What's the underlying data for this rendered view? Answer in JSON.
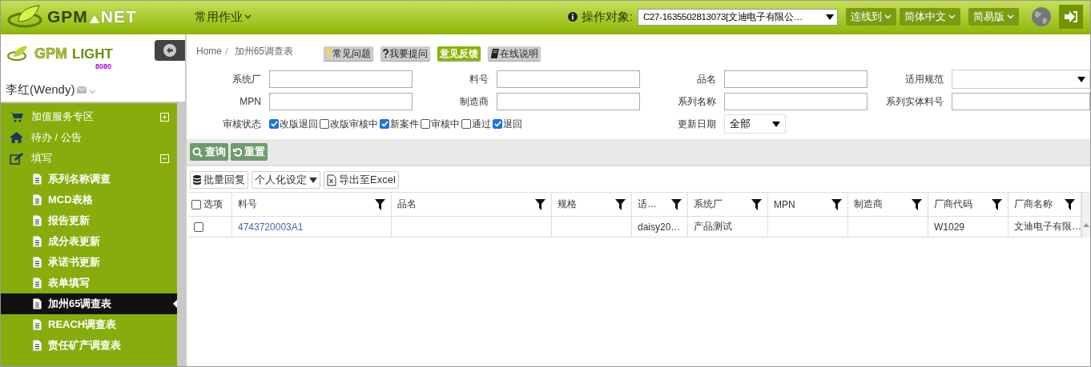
{
  "header": {
    "brand_left": "GPM",
    "brand_right": "NET",
    "menu": "常用作业",
    "operator_label": "操作对象:",
    "operator_value": "C27-1635502813073[文迪电子有限公…",
    "buttons": [
      "连线到",
      "简体中文",
      "简易版"
    ]
  },
  "sidebar": {
    "logo_left": "GPM",
    "logo_right": "LIGHT",
    "logo_sub": "8080",
    "user": "李红(Wendy)",
    "items": [
      {
        "label": "加值服务专区",
        "expanded": false
      },
      {
        "label": "待办 / 公告"
      },
      {
        "label": "填写",
        "expanded": true,
        "children": [
          {
            "label": "系列名称调查",
            "selected": false
          },
          {
            "label": "MCD表格",
            "selected": false
          },
          {
            "label": "报告更新",
            "selected": false
          },
          {
            "label": "成分表更新",
            "selected": false
          },
          {
            "label": "承诺书更新",
            "selected": false
          },
          {
            "label": "表单填写",
            "selected": false
          },
          {
            "label": "加州65调查表",
            "selected": true
          },
          {
            "label": "REACH调查表",
            "selected": false
          },
          {
            "label": "责任矿产调查表",
            "selected": false
          }
        ]
      }
    ]
  },
  "breadcrumb": [
    "Home",
    "加州65调查表"
  ],
  "breadcrumb_separator": "/",
  "help_buttons": [
    {
      "label": "常见问题",
      "highlight": false
    },
    {
      "label": "我要提问",
      "highlight": false
    },
    {
      "label": "意见反馈",
      "highlight": true
    },
    {
      "label": "在线说明",
      "highlight": false
    }
  ],
  "form": [
    {
      "label": "系统厂",
      "kind": "text"
    },
    {
      "label": "料号",
      "kind": "text"
    },
    {
      "label": "品名",
      "kind": "text"
    },
    {
      "label": "适用规范",
      "kind": "select"
    },
    {
      "label": "MPN",
      "kind": "text"
    },
    {
      "label": "制造商",
      "kind": "text"
    },
    {
      "label": "系列名称",
      "kind": "text"
    },
    {
      "label": "系列实体料号",
      "kind": "text"
    },
    {
      "label": "审核状态",
      "kind": "checks",
      "options": [
        {
          "label": "改版退回",
          "checked": true
        },
        {
          "label": "改版审核中",
          "checked": false
        },
        {
          "label": "新案件",
          "checked": true
        },
        {
          "label": "审核中",
          "checked": false
        },
        {
          "label": "通过",
          "checked": false
        },
        {
          "label": "退回",
          "checked": true
        }
      ]
    },
    {
      "label": "更新日期",
      "kind": "date-select",
      "value": "全部"
    }
  ],
  "actions": [
    {
      "label": "查询"
    },
    {
      "label": "重置"
    }
  ],
  "table_tools": [
    {
      "label": "批量回复",
      "kind": "db"
    },
    {
      "label": "个人化设定",
      "kind": "dropdown"
    },
    {
      "label": "导出至Excel",
      "kind": "excel"
    }
  ],
  "table": {
    "select_all_checked": false,
    "columns": [
      "选项",
      "料号",
      "品名",
      "规格",
      "适…",
      "系统厂",
      "MPN",
      "制造商",
      "厂商代码",
      "厂商名称"
    ],
    "rows": [
      {
        "checked": false,
        "cells": [
          "",
          "4743720003A1",
          "",
          "",
          "daisy20…",
          "产品测试",
          "",
          "",
          "W1029",
          "文迪电子有限…"
        ]
      }
    ]
  }
}
